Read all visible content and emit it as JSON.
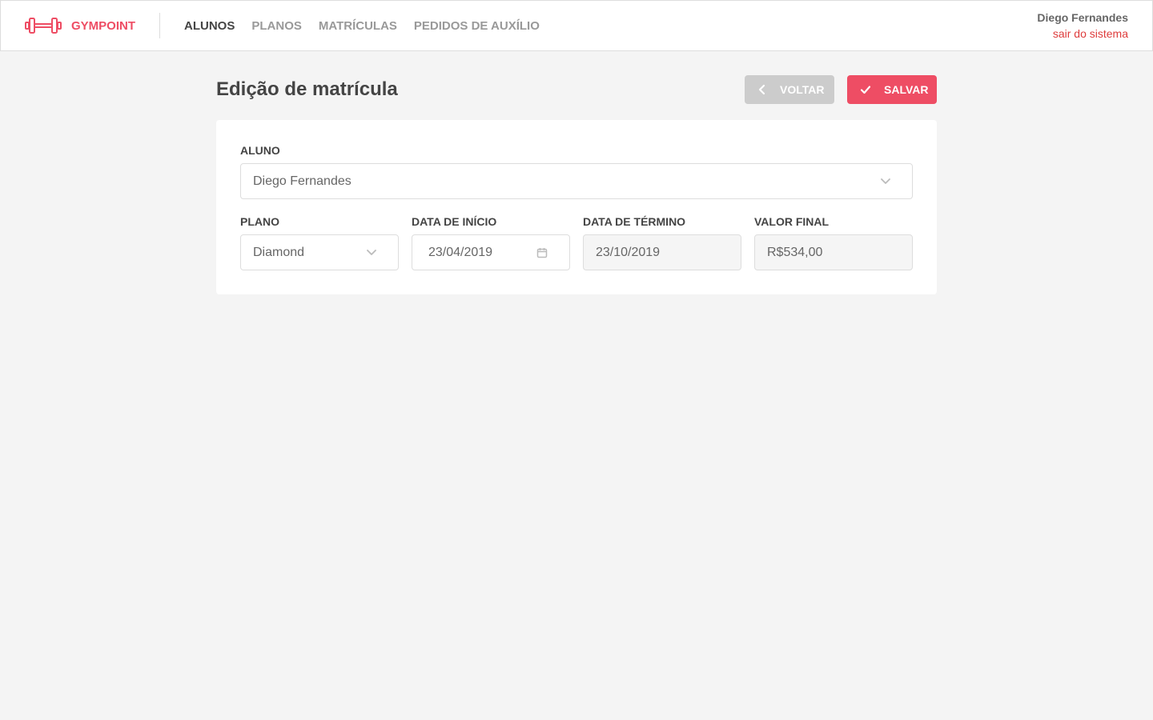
{
  "header": {
    "brand": "GYMPOINT",
    "nav": [
      "ALUNOS",
      "PLANOS",
      "MATRÍCULAS",
      "PEDIDOS DE AUXÍLIO"
    ],
    "active_nav": "ALUNOS",
    "user_name": "Diego Fernandes",
    "logout_label": "sair do sistema"
  },
  "page": {
    "title": "Edição de matrícula",
    "back_label": "VOLTAR",
    "save_label": "SALVAR"
  },
  "form": {
    "student": {
      "label": "ALUNO",
      "value": "Diego Fernandes"
    },
    "plan": {
      "label": "PLANO",
      "value": "Diamond"
    },
    "start_date": {
      "label": "DATA DE INÍCIO",
      "value": "23/04/2019"
    },
    "end_date": {
      "label": "DATA DE TÉRMINO",
      "value": "23/10/2019"
    },
    "final_price": {
      "label": "VALOR FINAL",
      "value": "R$534,00"
    }
  },
  "colors": {
    "accent": "#ee4d64",
    "logout": "#de3b3b",
    "back_button": "#cccccc",
    "background": "#f4f4f4"
  },
  "icons": [
    "dumbbell-icon",
    "chevron-left-icon",
    "check-icon",
    "chevron-down-icon",
    "calendar-icon"
  ]
}
